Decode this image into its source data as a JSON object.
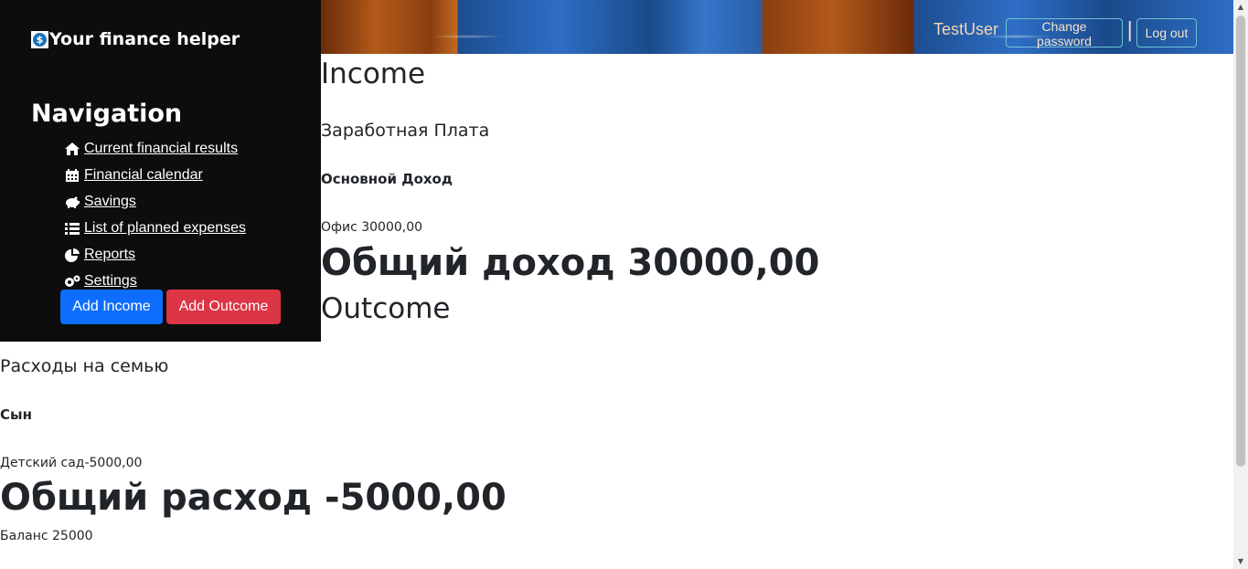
{
  "sidebar": {
    "brand": "Your finance helper",
    "brand_icon": "dollar-coin-icon",
    "nav_title": "Navigation",
    "items": [
      {
        "label": " Current financial results",
        "icon": "home-icon"
      },
      {
        "label": " Financial calendar",
        "icon": "calendar-icon"
      },
      {
        "label": " Savings",
        "icon": "piggy-bank-icon"
      },
      {
        "label": " List of planned expenses",
        "icon": "list-icon"
      },
      {
        "label": " Reports",
        "icon": "pie-chart-icon"
      },
      {
        "label": " Settings",
        "icon": "gears-icon"
      }
    ],
    "add_income": "Add Income",
    "add_outcome": "Add Outcome"
  },
  "header": {
    "user": "TestUser",
    "change_password": "Change password",
    "separator": "|",
    "logout": "Log out"
  },
  "income": {
    "title": "Income",
    "category": "Заработная Плата",
    "subcategory": "Основной Доход",
    "item": "Офис 30000,00",
    "total": "Общий доход 30000,00"
  },
  "outcome": {
    "title": "Outcome",
    "category": "Расходы на семью",
    "subcategory": "Сын",
    "item": "Детский сад-5000,00",
    "total": "Общий расход -5000,00"
  },
  "balance": "Баланс 25000",
  "colors": {
    "sidebar_bg": "#0d0d0d",
    "income_button": "#0d6efd",
    "outcome_button": "#dc3545",
    "header_button_border": "#6ec3d6"
  }
}
